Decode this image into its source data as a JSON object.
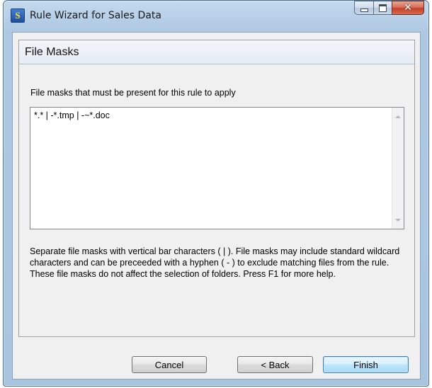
{
  "window": {
    "title": "Rule Wizard for Sales Data",
    "app_icon_text": "S",
    "caption_buttons": [
      "minimize",
      "maximize",
      "close"
    ]
  },
  "panel": {
    "title": "File Masks"
  },
  "masks": {
    "label": "File masks that must be present for this rule to apply",
    "value": "*.* | -*.tmp | -~*.doc"
  },
  "help": {
    "text": "Separate file masks with vertical bar characters ( | ).  File masks may include standard wildcard characters and can be preceeded with a hyphen ( - ) to exclude matching files from the rule. These file masks do not affect the selection of folders.  Press F1 for more help."
  },
  "buttons": {
    "cancel": "Cancel",
    "back": "< Back",
    "finish": "Finish"
  },
  "colors": {
    "title_bar": "#b4cde6",
    "close_button": "#c5412a",
    "default_button_border": "#3c7fb1",
    "dialog_background": "#f0f0f0"
  }
}
